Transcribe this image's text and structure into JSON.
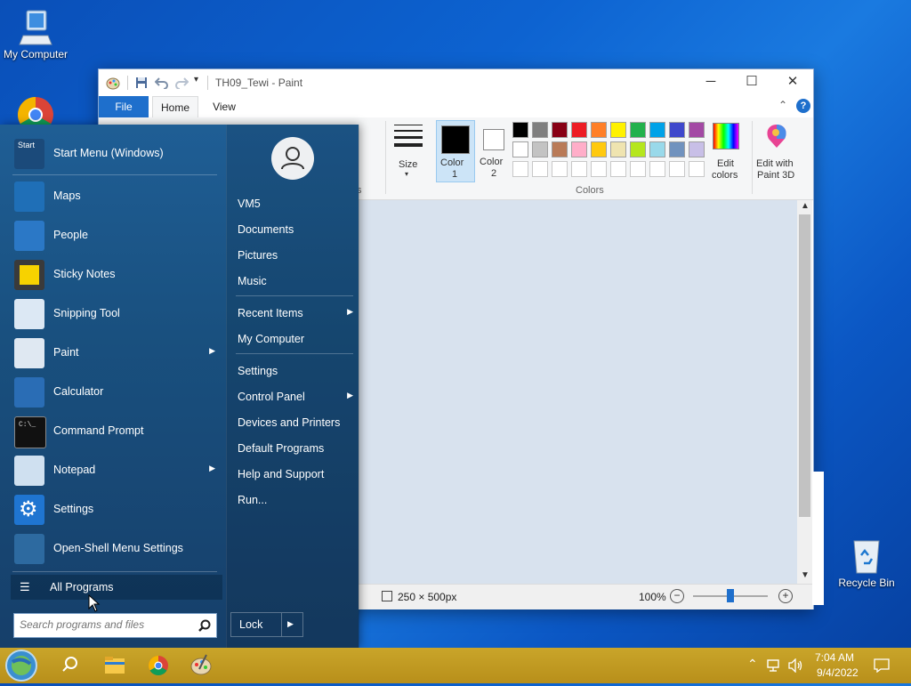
{
  "desktop": {
    "my_computer_label": "My Computer",
    "recycle_bin_label": "Recycle Bin"
  },
  "paint": {
    "title": "TH09_Tewi - Paint",
    "tabs": [
      "File",
      "Home",
      "View"
    ],
    "ribbon": {
      "partial_group_label": "s",
      "size_label": "Size",
      "color1_label": "Color 1",
      "color1_num": "1",
      "color1_word": "Color",
      "color2_word": "Color",
      "color2_num": "2",
      "edit_colors_line1": "Edit",
      "edit_colors_line2": "colors",
      "paint3d_line1": "Edit with",
      "paint3d_line2": "Paint 3D",
      "colors_group_label": "Colors"
    },
    "palette_row1": [
      "#000000",
      "#7f7f7f",
      "#880015",
      "#ed1c24",
      "#ff7f27",
      "#fff200",
      "#22b14c",
      "#00a2e8",
      "#3f48cc",
      "#a349a4"
    ],
    "palette_row2": [
      "#ffffff",
      "#c3c3c3",
      "#b97a57",
      "#ffaec9",
      "#ffc90e",
      "#efe4b0",
      "#b5e61d",
      "#99d9ea",
      "#7092be",
      "#c8bfe7"
    ],
    "status": {
      "dimensions": "250 × 500px",
      "zoom": "100%"
    }
  },
  "start_menu": {
    "left_items": [
      {
        "label": "Start Menu (Windows)",
        "icon": "start-menu-icon"
      },
      {
        "label": "Maps",
        "icon": "maps-icon"
      },
      {
        "label": "People",
        "icon": "people-icon"
      },
      {
        "label": "Sticky Notes",
        "icon": "sticky-notes-icon"
      },
      {
        "label": "Snipping Tool",
        "icon": "snipping-tool-icon"
      },
      {
        "label": "Paint",
        "icon": "paint-icon"
      },
      {
        "label": "Calculator",
        "icon": "calculator-icon"
      },
      {
        "label": "Command Prompt",
        "icon": "command-prompt-icon"
      },
      {
        "label": "Notepad",
        "icon": "notepad-icon"
      },
      {
        "label": "Settings",
        "icon": "settings-icon"
      },
      {
        "label": "Open-Shell Menu Settings",
        "icon": "open-shell-icon"
      }
    ],
    "start_icon_text": "Start",
    "all_programs": "All Programs",
    "search_placeholder": "Search programs and files",
    "right_items": [
      "VM5",
      "Documents",
      "Pictures",
      "Music",
      "Recent Items",
      "My Computer",
      "Settings",
      "Control Panel",
      "Devices and Printers",
      "Default Programs",
      "Help and Support",
      "Run..."
    ],
    "lock_label": "Lock"
  },
  "taskbar": {
    "time": "7:04 AM",
    "date": "9/4/2022"
  }
}
